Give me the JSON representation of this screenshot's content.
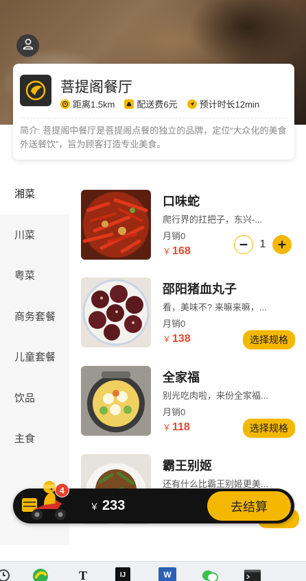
{
  "shop": {
    "name": "菩提阁餐厅",
    "distance": "距离1.5km",
    "delivery_fee": "配送费6元",
    "eta": "预计时长12min",
    "intro": "简介: 菩提阁中餐厅是菩提阁点餐的独立的品牌，定位“大众化的美食外送餐饮”，旨为顾客打造专业美食。"
  },
  "categories": [
    {
      "label": "湘菜",
      "active": true
    },
    {
      "label": "川菜"
    },
    {
      "label": "粤菜"
    },
    {
      "label": "商务套餐"
    },
    {
      "label": "儿童套餐"
    },
    {
      "label": "饮品"
    },
    {
      "label": "主食"
    }
  ],
  "dishes": [
    {
      "name": "口味蛇",
      "desc": "爬行界的扛把子，东兴-...",
      "sales": "月销0",
      "currency": "￥",
      "price": "168",
      "action": "stepper",
      "quantity": "1"
    },
    {
      "name": "邵阳猪血丸子",
      "desc": "看，美味不? 来嘛来嘛，...",
      "sales": "月销0",
      "currency": "￥",
      "price": "138",
      "action": "spec",
      "spec_label": "选择规格"
    },
    {
      "name": "全家福",
      "desc": "别光吃肉啦，来份全家福...",
      "sales": "月销0",
      "currency": "￥",
      "price": "118",
      "action": "spec",
      "spec_label": "选择规格"
    },
    {
      "name": "霸王别姬",
      "desc": "还有什么比霸王别姬更美...",
      "sales": "",
      "currency": "",
      "price": ""
    }
  ],
  "cart": {
    "badge_count": "4",
    "currency": "￥",
    "total": "233",
    "checkout_label": "去结算"
  },
  "taskbar": {
    "icons": [
      "clock-icon",
      "app-green-icon",
      "text-editor-icon",
      "intellij-icon",
      "word-icon",
      "wechat-icon",
      "terminal-icon"
    ],
    "text_label": "T",
    "ij_label": "IJ",
    "word_label": "W"
  },
  "colors": {
    "accent": "#f5b800",
    "price": "#e5482f",
    "cart_bg": "#121212",
    "badge": "#e8412f"
  }
}
